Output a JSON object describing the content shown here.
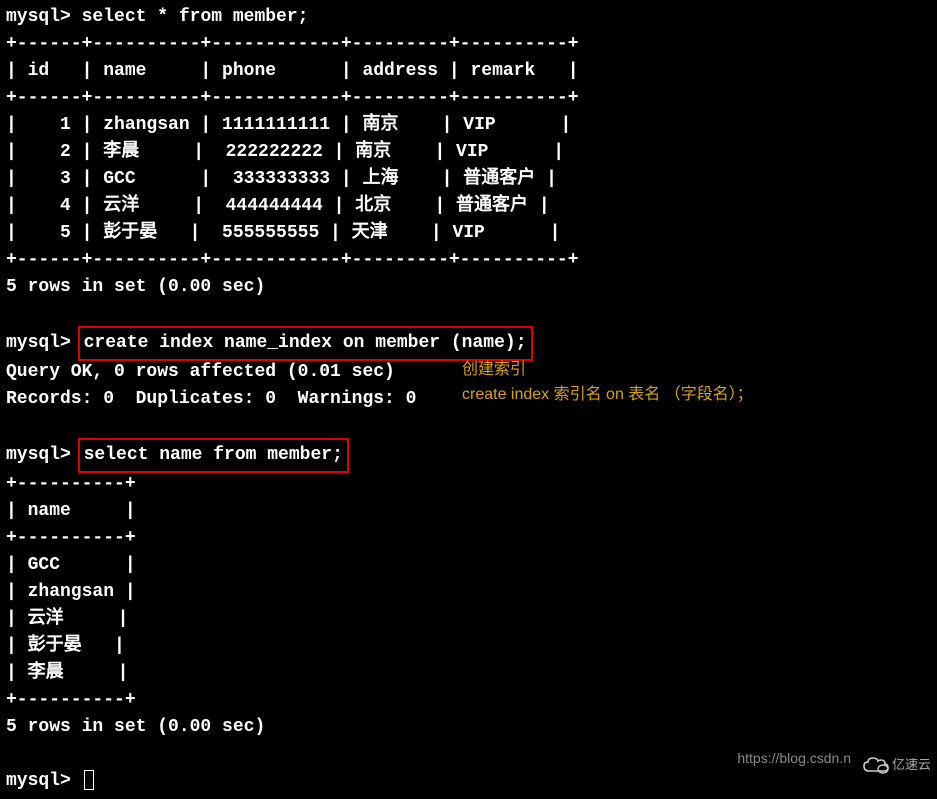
{
  "prompt": "mysql>",
  "query1": "select * from member;",
  "table1": {
    "border_top": "+------+----------+------------+---------+----------+",
    "header": "| id   | name     | phone      | address | remark   |",
    "border_mid": "+------+----------+------------+---------+----------+",
    "rows": [
      "|    1 | zhangsan | 1111111111 | 南京    | VIP      |",
      "|    2 | 李晨     |  222222222 | 南京    | VIP      |",
      "|    3 | GCC      |  333333333 | 上海    | 普通客户 |",
      "|    4 | 云洋     |  444444444 | 北京    | 普通客户 |",
      "|    5 | 彭于晏   |  555555555 | 天津    | VIP      |"
    ],
    "border_bot": "+------+----------+------------+---------+----------+"
  },
  "result1": "5 rows in set (0.00 sec)",
  "query2": "create index name_index on member (name);",
  "query2_result1": "Query OK, 0 rows affected (0.01 sec)",
  "query2_result2": "Records: 0  Duplicates: 0  Warnings: 0",
  "annotation1": "创建索引",
  "annotation2": "create index 索引名 on 表名 （字段名）；",
  "query3": "select name from member;",
  "table2": {
    "border_top": "+----------+",
    "header": "| name     |",
    "border_mid": "+----------+",
    "rows": [
      "| GCC      |",
      "| zhangsan |",
      "| 云洋     |",
      "| 彭于晏   |",
      "| 李晨     |"
    ],
    "border_bot": "+----------+"
  },
  "result3": "5 rows in set (0.00 sec)",
  "watermark_text": "https://blog.csdn.n",
  "watermark_brand": "亿速云"
}
